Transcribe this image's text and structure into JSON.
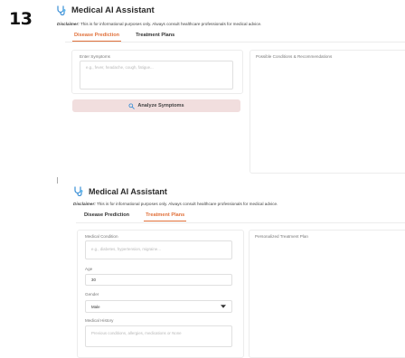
{
  "step_label": "13",
  "top": {
    "title": "Medical AI Assistant",
    "disclaimer_prefix": "Disclaimer:",
    "disclaimer_text": " This is for informational purposes only. Always consult healthcare professionals for medical advice.",
    "tabs": [
      "Disease Prediction",
      "Treatment Plans"
    ],
    "active_tab": "Disease Prediction",
    "symptoms_label": "Enter Symptoms",
    "symptoms_placeholder": "e.g., fever, headache, cough, fatigue...",
    "analyze_button": "Analyze Symptoms",
    "results_label": "Possible Conditions & Recommendations"
  },
  "bottom": {
    "title": "Medical AI Assistant",
    "disclaimer_prefix": "Disclaimer:",
    "disclaimer_text": " This is for informational purposes only. Always consult healthcare professionals for medical advice.",
    "tabs": [
      "Disease Prediction",
      "Treatment Plans"
    ],
    "active_tab": "Treatment Plans",
    "condition_label": "Medical Condition",
    "condition_placeholder": "e.g., diabetes, hypertension, migraine...",
    "age_label": "Age",
    "age_value": "30",
    "gender_label": "Gender",
    "gender_value": "Male",
    "history_label": "Medical History",
    "history_placeholder": "Previous conditions, allergies, medications or None",
    "plan_label": "Personalized Treatment Plan"
  },
  "colors": {
    "accent": "#e0703a",
    "icon_blue": "#3a8fd6",
    "button_bg": "#f1dede"
  }
}
